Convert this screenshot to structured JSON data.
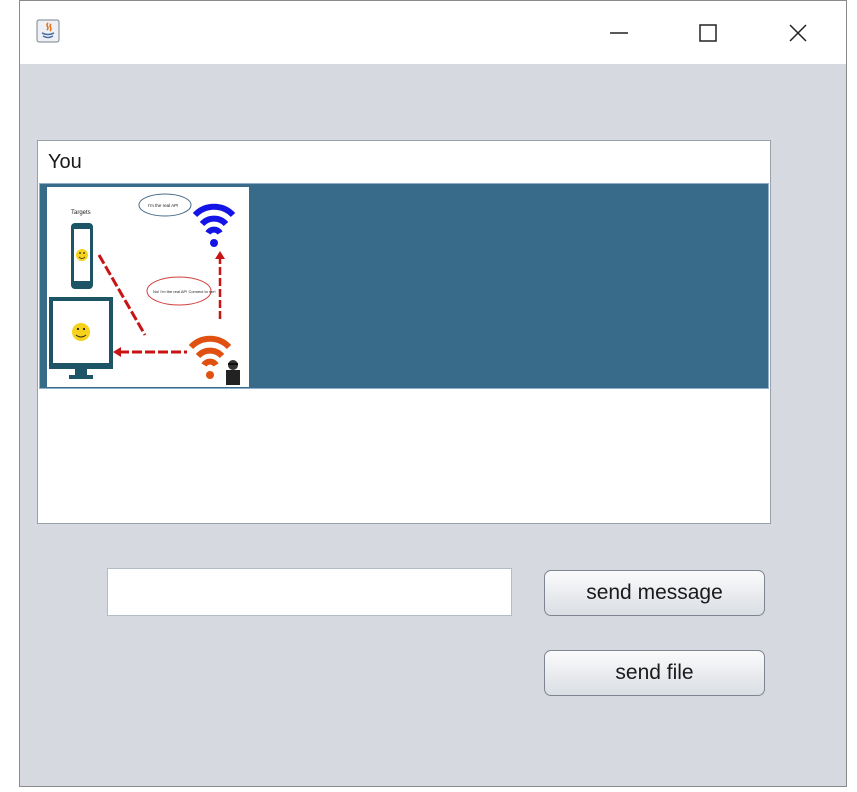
{
  "window": {
    "title": "",
    "controls": {
      "minimize": "minimize-icon",
      "maximize": "maximize-icon",
      "close": "close-icon"
    }
  },
  "chat": {
    "messages": [
      {
        "sender": "You",
        "type": "image",
        "image_texts": [
          "Targets",
          "I'm the real AP!",
          "No! I'm the real AP! Connect to me!"
        ]
      }
    ]
  },
  "composer": {
    "input_value": "",
    "send_message_label": "send message",
    "send_file_label": "send file"
  },
  "colors": {
    "window_bg": "#d6d9e0",
    "selected_row": "#386b8a",
    "wifi_legit": "#1414e6",
    "wifi_rogue": "#e05010"
  }
}
